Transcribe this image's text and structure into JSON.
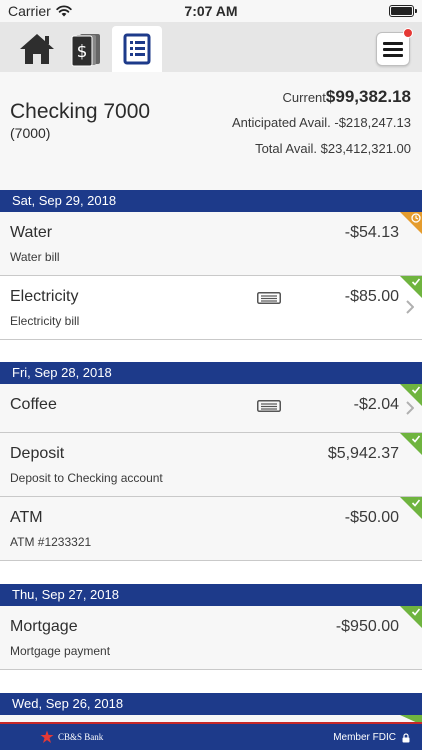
{
  "status_bar": {
    "carrier": "Carrier",
    "time": "7:07 AM"
  },
  "tabs": [
    {
      "icon": "home-icon",
      "active": false
    },
    {
      "icon": "money-icon",
      "active": false
    },
    {
      "icon": "register-icon",
      "active": true
    }
  ],
  "account": {
    "name": "Checking 7000",
    "number": "(7000)",
    "current_label": "Current",
    "current_amount": "$99,382.18",
    "anticipated_label": "Anticipated Avail.",
    "anticipated_amount": "-$218,247.13",
    "total_label": "Total Avail.",
    "total_amount": "$23,412,321.00"
  },
  "groups": [
    {
      "date": "Sat, Sep 29, 2018",
      "transactions": [
        {
          "title": "Water",
          "amount": "-$54.13",
          "description": "Water bill",
          "status": "pending"
        },
        {
          "title": "Electricity",
          "amount": "-$85.00",
          "description": "Electricity bill",
          "status": "cleared"
        }
      ]
    },
    {
      "date": "Fri, Sep 28, 2018",
      "transactions": [
        {
          "title": "Coffee",
          "amount": "-$2.04",
          "description": "",
          "status": "cleared"
        },
        {
          "title": "Deposit",
          "amount": "$5,942.37",
          "description": "Deposit to Checking account",
          "status": "cleared"
        },
        {
          "title": "ATM",
          "amount": "-$50.00",
          "description": "ATM #1233321",
          "status": "cleared"
        }
      ]
    },
    {
      "date": "Thu, Sep 27, 2018",
      "transactions": [
        {
          "title": "Mortgage",
          "amount": "-$950.00",
          "description": "Mortgage payment",
          "status": "cleared"
        }
      ]
    },
    {
      "date": "Wed, Sep 26, 2018",
      "transactions": []
    }
  ],
  "footer": {
    "bank_name": "CB&S Bank",
    "fdic": "Member FDIC"
  },
  "colors": {
    "navy": "#1d3a8a",
    "cleared": "#6fb43f",
    "pending": "#e59c2d",
    "badge": "#e53935"
  }
}
